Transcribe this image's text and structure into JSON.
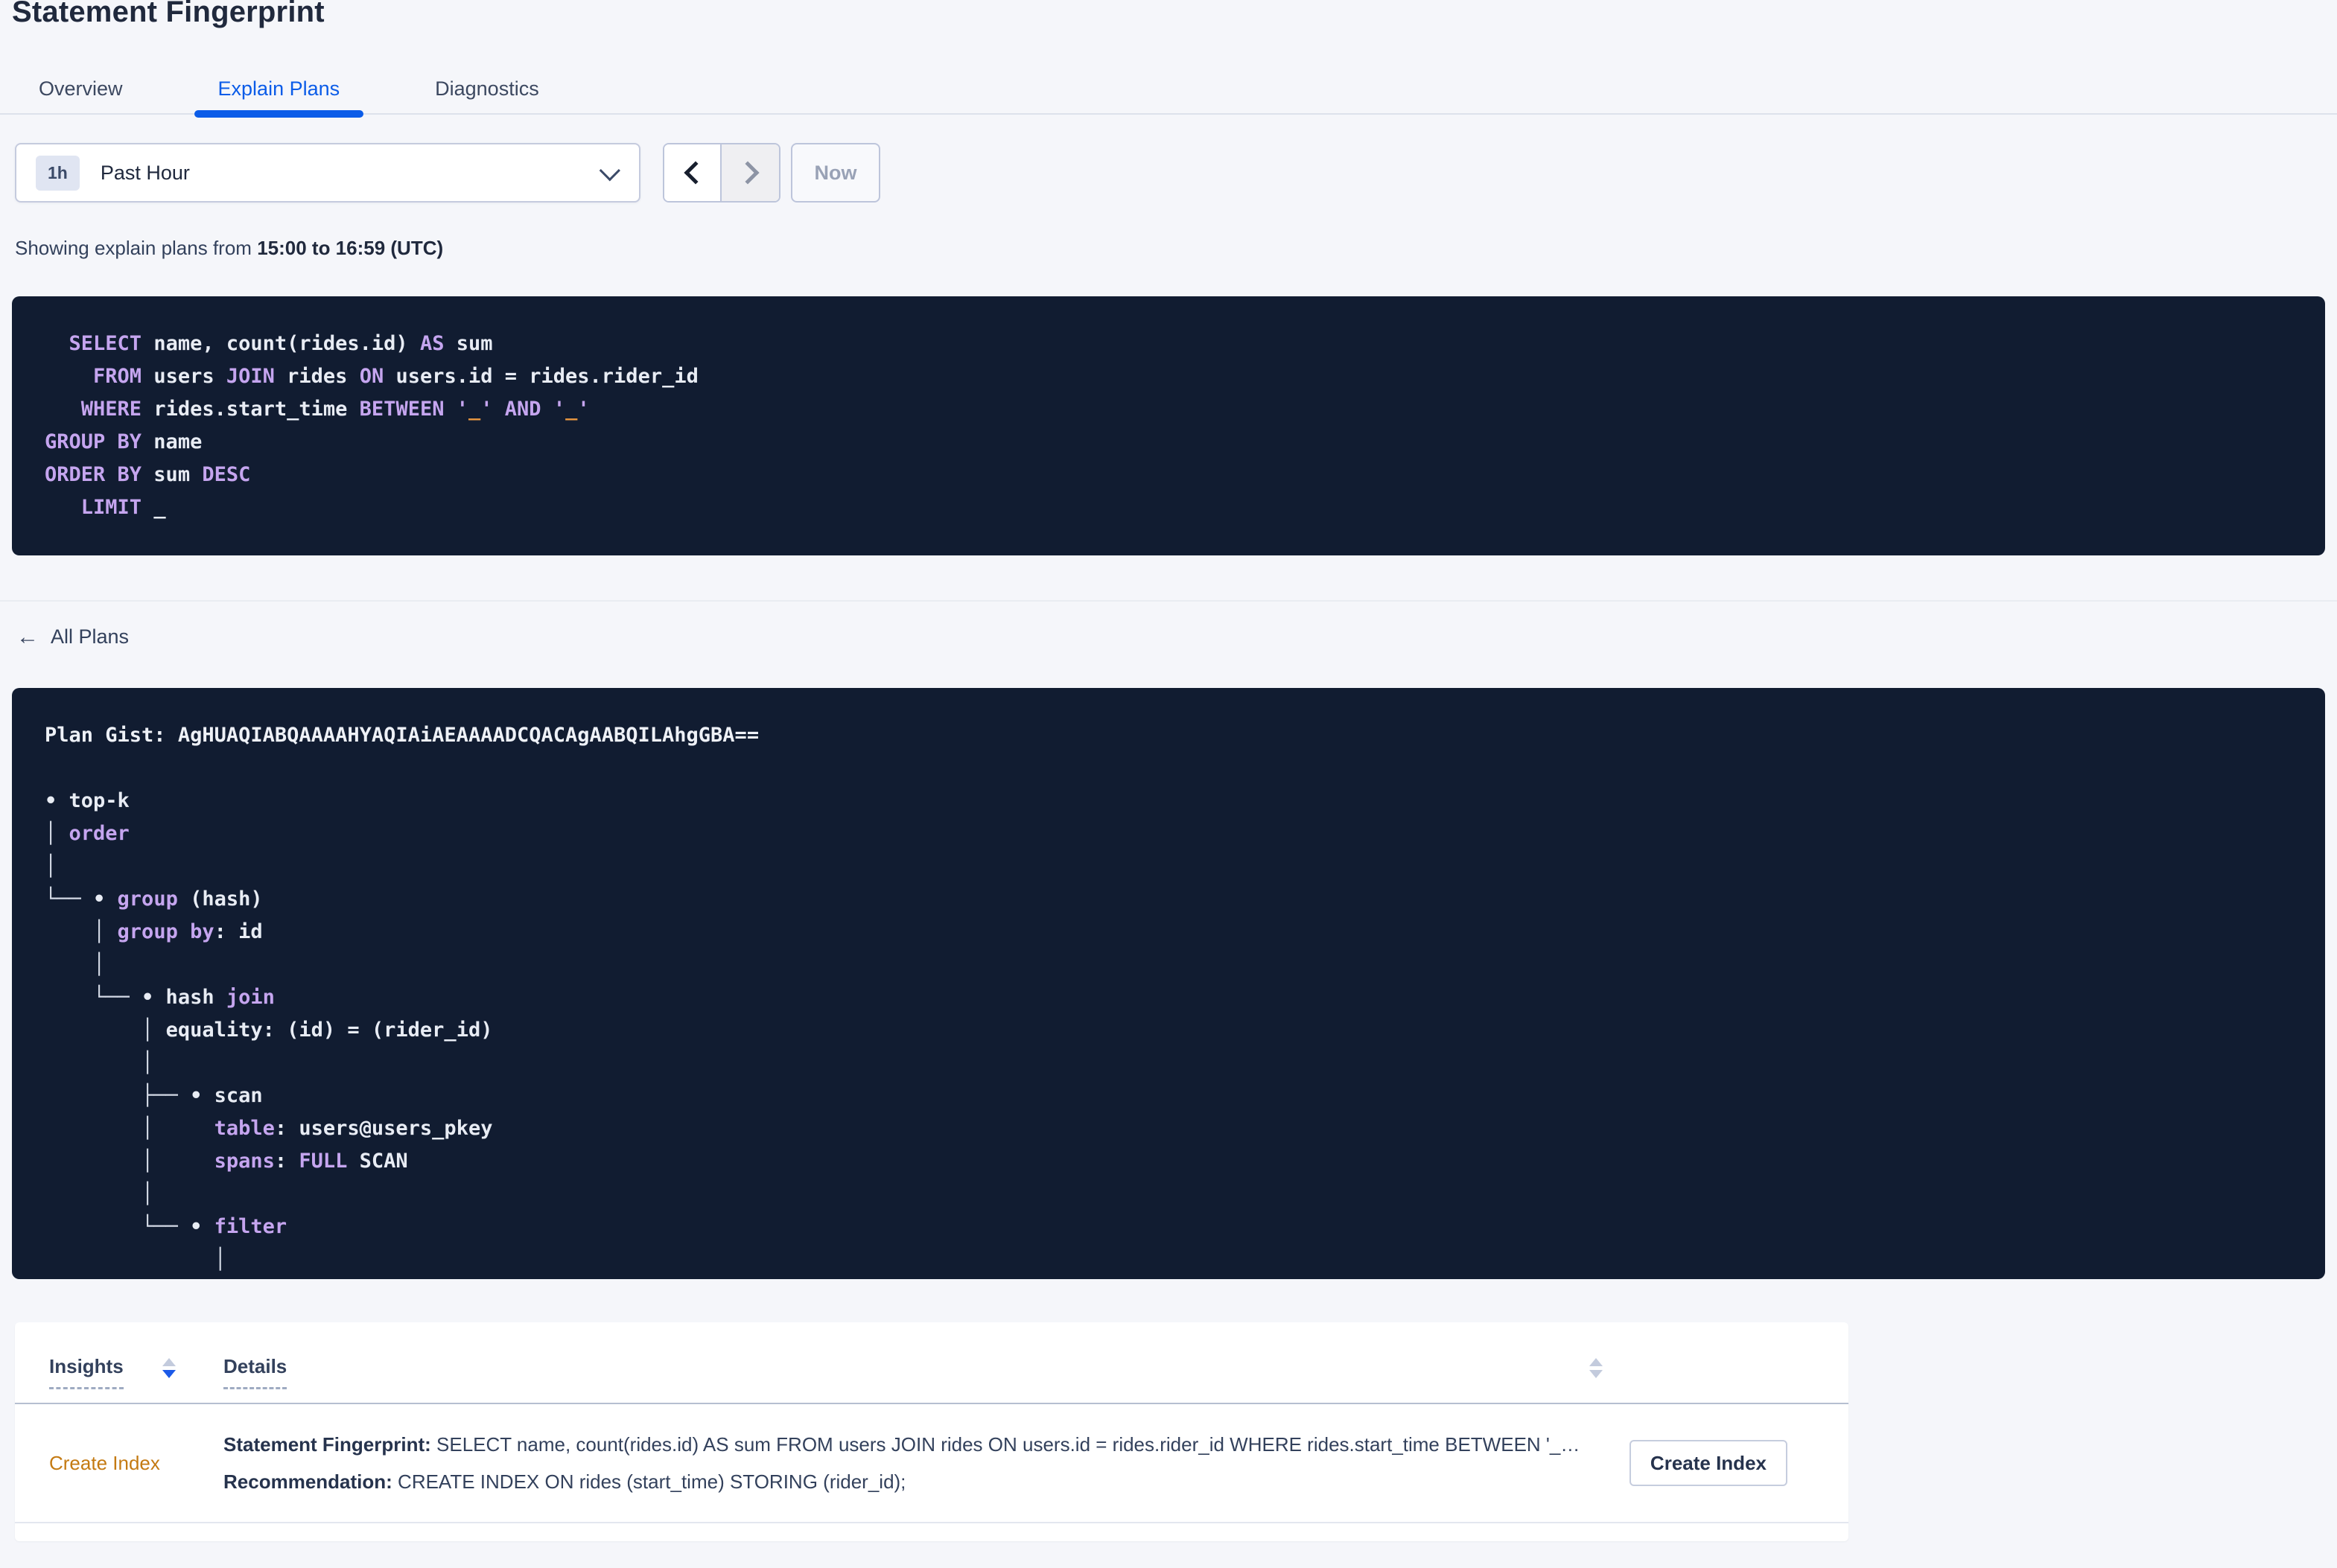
{
  "page": {
    "title": "Statement Fingerprint"
  },
  "tabs": [
    {
      "label": "Overview",
      "active": false
    },
    {
      "label": "Explain Plans",
      "active": true
    },
    {
      "label": "Diagnostics",
      "active": false
    }
  ],
  "time_selector": {
    "badge": "1h",
    "label": "Past Hour",
    "now_label": "Now",
    "prev_enabled": true,
    "next_enabled": false
  },
  "showing": {
    "prefix": "Showing explain plans from ",
    "range": "15:00 to 16:59 (UTC)"
  },
  "colors": {
    "accent_blue": "#0b5ce8",
    "panel_background": "#111c31",
    "code_keyword_purple": "#c5a5ef",
    "code_literal_orange": "#e39440",
    "insight_link_orange": "#c47a12",
    "sort_active_blue": "#1c5ae8"
  },
  "sql": {
    "lines": [
      [
        {
          "t": "  "
        },
        {
          "t": "SELECT",
          "c": "kw"
        },
        {
          "t": " name, count(rides.id) "
        },
        {
          "t": "AS",
          "c": "kw"
        },
        {
          "t": " sum"
        }
      ],
      [
        {
          "t": "    "
        },
        {
          "t": "FROM",
          "c": "kw"
        },
        {
          "t": " users "
        },
        {
          "t": "JOIN",
          "c": "kw"
        },
        {
          "t": " rides "
        },
        {
          "t": "ON",
          "c": "kw"
        },
        {
          "t": " users.id = rides.rider_id"
        }
      ],
      [
        {
          "t": "   "
        },
        {
          "t": "WHERE",
          "c": "kw"
        },
        {
          "t": " rides.start_time "
        },
        {
          "t": "BETWEEN",
          "c": "kw"
        },
        {
          "t": " "
        },
        {
          "t": "'",
          "c": "kw"
        },
        {
          "t": "_",
          "c": "lit"
        },
        {
          "t": "'",
          "c": "kw"
        },
        {
          "t": " "
        },
        {
          "t": "AND",
          "c": "kw"
        },
        {
          "t": " "
        },
        {
          "t": "'",
          "c": "kw"
        },
        {
          "t": "_",
          "c": "lit"
        },
        {
          "t": "'",
          "c": "kw"
        }
      ],
      [
        {
          "t": "GROUP BY",
          "c": "kw"
        },
        {
          "t": " name"
        }
      ],
      [
        {
          "t": "ORDER BY",
          "c": "kw"
        },
        {
          "t": " sum "
        },
        {
          "t": "DESC",
          "c": "kw"
        }
      ],
      [
        {
          "t": "   "
        },
        {
          "t": "LIMIT",
          "c": "kw"
        },
        {
          "t": " _"
        }
      ]
    ]
  },
  "all_plans": {
    "arrow": "←",
    "label": "All Plans"
  },
  "plan": {
    "gist_label": "Plan Gist: ",
    "gist": "AgHUAQIABQAAAAHYAQIAiAEAAAADCQACAgAABQILAhgGBA==",
    "tree": [
      [
        {
          "t": "• top-k"
        }
      ],
      [
        {
          "t": "│ ",
          "c": "tree"
        },
        {
          "t": "order",
          "c": "kw"
        }
      ],
      [
        {
          "t": "│",
          "c": "tree"
        }
      ],
      [
        {
          "t": "└── ",
          "c": "tree"
        },
        {
          "t": "• "
        },
        {
          "t": "group",
          "c": "kw"
        },
        {
          "t": " (hash)"
        }
      ],
      [
        {
          "t": "    │ ",
          "c": "tree"
        },
        {
          "t": "group by",
          "c": "kw"
        },
        {
          "t": ": id"
        }
      ],
      [
        {
          "t": "    │",
          "c": "tree"
        }
      ],
      [
        {
          "t": "    └── ",
          "c": "tree"
        },
        {
          "t": "• hash "
        },
        {
          "t": "join",
          "c": "kw"
        }
      ],
      [
        {
          "t": "        │ ",
          "c": "tree"
        },
        {
          "t": "equality: (id) = (rider_id)"
        }
      ],
      [
        {
          "t": "        │",
          "c": "tree"
        }
      ],
      [
        {
          "t": "        ├── ",
          "c": "tree"
        },
        {
          "t": "• scan"
        }
      ],
      [
        {
          "t": "        │     ",
          "c": "tree"
        },
        {
          "t": "table",
          "c": "kw"
        },
        {
          "t": ": users@users_pkey"
        }
      ],
      [
        {
          "t": "        │     ",
          "c": "tree"
        },
        {
          "t": "spans",
          "c": "kw"
        },
        {
          "t": ": "
        },
        {
          "t": "FULL",
          "c": "kw"
        },
        {
          "t": " SCAN"
        }
      ],
      [
        {
          "t": "        │",
          "c": "tree"
        }
      ],
      [
        {
          "t": "        └── ",
          "c": "tree"
        },
        {
          "t": "• "
        },
        {
          "t": "filter",
          "c": "kw"
        }
      ],
      [
        {
          "t": "              │",
          "c": "tree"
        }
      ]
    ]
  },
  "insights_table": {
    "columns": [
      {
        "label": "Insights"
      },
      {
        "label": "Details"
      }
    ],
    "rows": [
      {
        "insight": "Create Index",
        "details": [
          {
            "label": "Statement Fingerprint:",
            "text": " SELECT name, count(rides.id) AS sum FROM users JOIN rides ON users.id = rides.rider_id WHERE rides.start_time BETWEEN '_…"
          },
          {
            "label": "Recommendation:",
            "text": " CREATE INDEX ON rides (start_time) STORING (rider_id);"
          }
        ],
        "action_label": "Create Index"
      }
    ]
  }
}
